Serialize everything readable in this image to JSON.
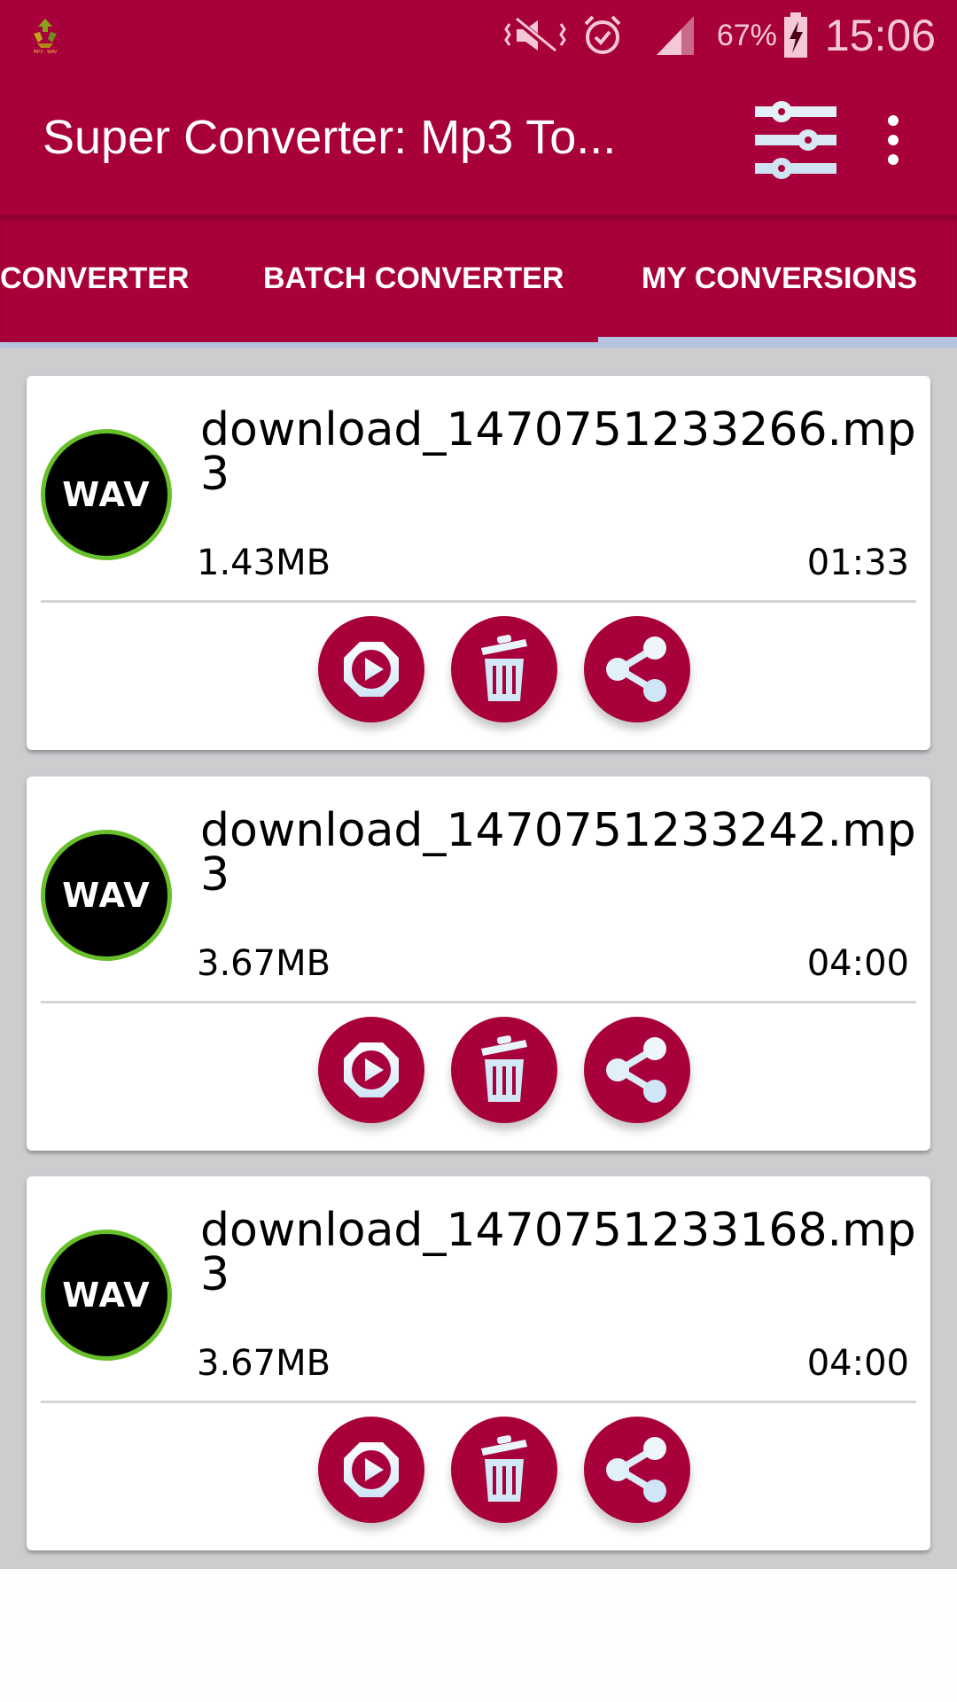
{
  "status_bar": {
    "app_icon": "recycle-mp3-wav-icon",
    "icons": [
      "vibrate-mute-icon",
      "alarm-icon",
      "signal-icon",
      "battery-charging-icon"
    ],
    "battery": "67%",
    "time": "15:06"
  },
  "toolbar": {
    "title": "Super Converter: Mp3 To...",
    "tune_icon": "tune-sliders-icon",
    "more_icon": "more-vert-icon"
  },
  "tabs": [
    {
      "label": "CONVERTER",
      "selected": false
    },
    {
      "label": "BATCH CONVERTER",
      "selected": false
    },
    {
      "label": "MY CONVERSIONS",
      "selected": true
    }
  ],
  "colors": {
    "primary": "#a8003b",
    "indicator": "#b5c2e0",
    "avatar_ring": "#67c02a",
    "background": "#cdcccf"
  },
  "conversions": [
    {
      "format": "WAV",
      "name": "download_1470751233266.mp3",
      "size": "1.43MB",
      "duration": "01:33"
    },
    {
      "format": "WAV",
      "name": "download_1470751233242.mp3",
      "size": "3.67MB",
      "duration": "04:00"
    },
    {
      "format": "WAV",
      "name": "download_1470751233168.mp3",
      "size": "3.67MB",
      "duration": "04:00"
    }
  ],
  "actions": {
    "play": "play-icon",
    "delete": "trash-icon",
    "share": "share-icon"
  }
}
